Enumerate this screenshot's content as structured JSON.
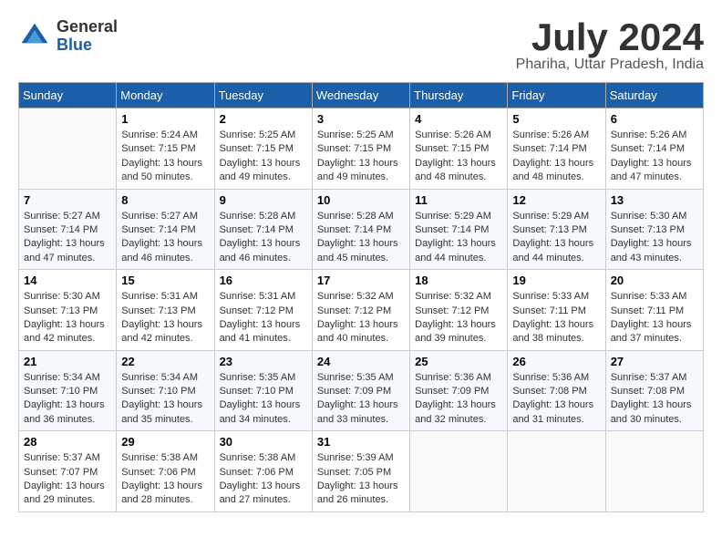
{
  "logo": {
    "general": "General",
    "blue": "Blue"
  },
  "title": "July 2024",
  "subtitle": "Phariha, Uttar Pradesh, India",
  "days_of_week": [
    "Sunday",
    "Monday",
    "Tuesday",
    "Wednesday",
    "Thursday",
    "Friday",
    "Saturday"
  ],
  "weeks": [
    [
      {
        "num": "",
        "info": ""
      },
      {
        "num": "1",
        "info": "Sunrise: 5:24 AM\nSunset: 7:15 PM\nDaylight: 13 hours\nand 50 minutes."
      },
      {
        "num": "2",
        "info": "Sunrise: 5:25 AM\nSunset: 7:15 PM\nDaylight: 13 hours\nand 49 minutes."
      },
      {
        "num": "3",
        "info": "Sunrise: 5:25 AM\nSunset: 7:15 PM\nDaylight: 13 hours\nand 49 minutes."
      },
      {
        "num": "4",
        "info": "Sunrise: 5:26 AM\nSunset: 7:15 PM\nDaylight: 13 hours\nand 48 minutes."
      },
      {
        "num": "5",
        "info": "Sunrise: 5:26 AM\nSunset: 7:14 PM\nDaylight: 13 hours\nand 48 minutes."
      },
      {
        "num": "6",
        "info": "Sunrise: 5:26 AM\nSunset: 7:14 PM\nDaylight: 13 hours\nand 47 minutes."
      }
    ],
    [
      {
        "num": "7",
        "info": "Sunrise: 5:27 AM\nSunset: 7:14 PM\nDaylight: 13 hours\nand 47 minutes."
      },
      {
        "num": "8",
        "info": "Sunrise: 5:27 AM\nSunset: 7:14 PM\nDaylight: 13 hours\nand 46 minutes."
      },
      {
        "num": "9",
        "info": "Sunrise: 5:28 AM\nSunset: 7:14 PM\nDaylight: 13 hours\nand 46 minutes."
      },
      {
        "num": "10",
        "info": "Sunrise: 5:28 AM\nSunset: 7:14 PM\nDaylight: 13 hours\nand 45 minutes."
      },
      {
        "num": "11",
        "info": "Sunrise: 5:29 AM\nSunset: 7:14 PM\nDaylight: 13 hours\nand 44 minutes."
      },
      {
        "num": "12",
        "info": "Sunrise: 5:29 AM\nSunset: 7:13 PM\nDaylight: 13 hours\nand 44 minutes."
      },
      {
        "num": "13",
        "info": "Sunrise: 5:30 AM\nSunset: 7:13 PM\nDaylight: 13 hours\nand 43 minutes."
      }
    ],
    [
      {
        "num": "14",
        "info": "Sunrise: 5:30 AM\nSunset: 7:13 PM\nDaylight: 13 hours\nand 42 minutes."
      },
      {
        "num": "15",
        "info": "Sunrise: 5:31 AM\nSunset: 7:13 PM\nDaylight: 13 hours\nand 42 minutes."
      },
      {
        "num": "16",
        "info": "Sunrise: 5:31 AM\nSunset: 7:12 PM\nDaylight: 13 hours\nand 41 minutes."
      },
      {
        "num": "17",
        "info": "Sunrise: 5:32 AM\nSunset: 7:12 PM\nDaylight: 13 hours\nand 40 minutes."
      },
      {
        "num": "18",
        "info": "Sunrise: 5:32 AM\nSunset: 7:12 PM\nDaylight: 13 hours\nand 39 minutes."
      },
      {
        "num": "19",
        "info": "Sunrise: 5:33 AM\nSunset: 7:11 PM\nDaylight: 13 hours\nand 38 minutes."
      },
      {
        "num": "20",
        "info": "Sunrise: 5:33 AM\nSunset: 7:11 PM\nDaylight: 13 hours\nand 37 minutes."
      }
    ],
    [
      {
        "num": "21",
        "info": "Sunrise: 5:34 AM\nSunset: 7:10 PM\nDaylight: 13 hours\nand 36 minutes."
      },
      {
        "num": "22",
        "info": "Sunrise: 5:34 AM\nSunset: 7:10 PM\nDaylight: 13 hours\nand 35 minutes."
      },
      {
        "num": "23",
        "info": "Sunrise: 5:35 AM\nSunset: 7:10 PM\nDaylight: 13 hours\nand 34 minutes."
      },
      {
        "num": "24",
        "info": "Sunrise: 5:35 AM\nSunset: 7:09 PM\nDaylight: 13 hours\nand 33 minutes."
      },
      {
        "num": "25",
        "info": "Sunrise: 5:36 AM\nSunset: 7:09 PM\nDaylight: 13 hours\nand 32 minutes."
      },
      {
        "num": "26",
        "info": "Sunrise: 5:36 AM\nSunset: 7:08 PM\nDaylight: 13 hours\nand 31 minutes."
      },
      {
        "num": "27",
        "info": "Sunrise: 5:37 AM\nSunset: 7:08 PM\nDaylight: 13 hours\nand 30 minutes."
      }
    ],
    [
      {
        "num": "28",
        "info": "Sunrise: 5:37 AM\nSunset: 7:07 PM\nDaylight: 13 hours\nand 29 minutes."
      },
      {
        "num": "29",
        "info": "Sunrise: 5:38 AM\nSunset: 7:06 PM\nDaylight: 13 hours\nand 28 minutes."
      },
      {
        "num": "30",
        "info": "Sunrise: 5:38 AM\nSunset: 7:06 PM\nDaylight: 13 hours\nand 27 minutes."
      },
      {
        "num": "31",
        "info": "Sunrise: 5:39 AM\nSunset: 7:05 PM\nDaylight: 13 hours\nand 26 minutes."
      },
      {
        "num": "",
        "info": ""
      },
      {
        "num": "",
        "info": ""
      },
      {
        "num": "",
        "info": ""
      }
    ]
  ]
}
